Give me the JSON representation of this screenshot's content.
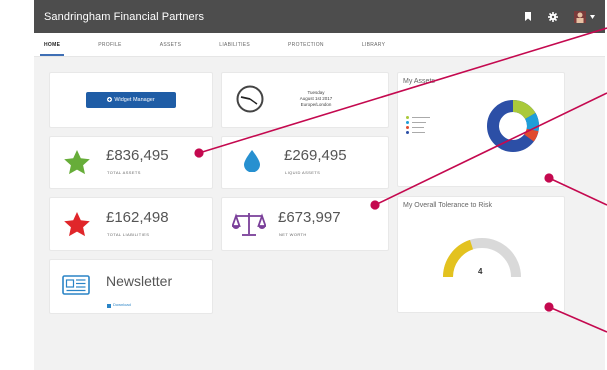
{
  "app": {
    "title": "Sandringham Financial Partners"
  },
  "nav": {
    "tabs": [
      "HOME",
      "PROFILE",
      "ASSETS",
      "LIABILITIES",
      "PROTECTION",
      "LIBRARY"
    ]
  },
  "widget_manager": {
    "label": "Widget Manager"
  },
  "date_card": {
    "day": "Tuesday",
    "date": "August 1st 2017",
    "location": "Europe/London"
  },
  "total_assets": {
    "amount": "£836,495",
    "label": "TOTAL ASSETS"
  },
  "liquid_assets": {
    "amount": "£269,495",
    "label": "LIQUID ASSETS"
  },
  "total_liabilities": {
    "amount": "£162,498",
    "label": "TOTAL LIABILITIES"
  },
  "net_worth": {
    "amount": "£673,997",
    "label": "NET WORTH"
  },
  "newsletter": {
    "title": "Newsletter",
    "link": "Download"
  },
  "assets_chart": {
    "title": "My Assets",
    "colors": {
      "c1": "#a9c93a",
      "c2": "#1f9ed8",
      "c3": "#e04b2f",
      "c4": "#2c4fa6"
    }
  },
  "risk": {
    "title": "My Overall Tolerance to Risk",
    "value": "4",
    "level_fraction": 0.4,
    "fill_color": "#e3c21f"
  },
  "icons": [
    "bookmark-icon",
    "gear-icon",
    "user-avatar-icon",
    "chevron-down-icon",
    "clock-icon",
    "star-icon",
    "water-drop-icon",
    "scales-icon",
    "newsletter-icon",
    "download-icon"
  ]
}
